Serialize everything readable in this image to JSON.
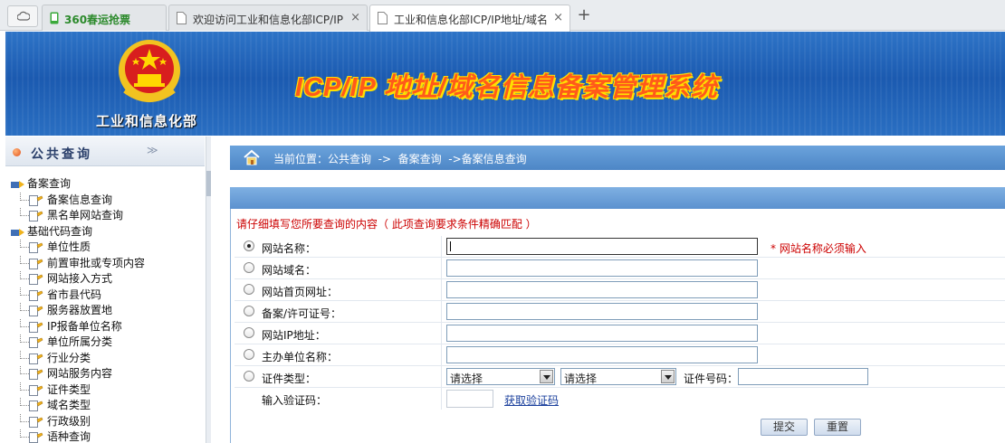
{
  "browser": {
    "tabs": [
      {
        "title": "360春运抢票",
        "active": false
      },
      {
        "title": "欢迎访问工业和信息化部ICP/IP",
        "active": false
      },
      {
        "title": "工业和信息化部ICP/IP地址/域名",
        "active": true
      }
    ],
    "close_glyph": "×",
    "new_tab_glyph": "+"
  },
  "banner": {
    "ministry": "工业和信息化部",
    "title": "ICP/IP 地址/域名信息备案管理系统"
  },
  "sidebar": {
    "title": "公共查询",
    "chevron": "≫",
    "groups": [
      {
        "label": "备案查询",
        "items": [
          "备案信息查询",
          "黑名单网站查询"
        ]
      },
      {
        "label": "基础代码查询",
        "items": [
          "单位性质",
          "前置审批或专项内容",
          "网站接入方式",
          "省市县代码",
          "服务器放置地",
          "IP报备单位名称",
          "单位所属分类",
          "行业分类",
          "网站服务内容",
          "证件类型",
          "域名类型",
          "行政级别",
          "语种查询"
        ]
      }
    ]
  },
  "breadcrumb": {
    "text": "当前位置：公共查询  ->  备案查询  ->备案信息查询"
  },
  "form": {
    "note": "请仔细填写您所要查询的内容（ 此项查询要求条件精确匹配 ）",
    "fields": [
      {
        "label": "网站名称：",
        "value": "",
        "checked": true
      },
      {
        "label": "网站域名：",
        "value": "",
        "checked": false
      },
      {
        "label": "网站首页网址：",
        "value": "",
        "checked": false
      },
      {
        "label": "备案/许可证号：",
        "value": "",
        "checked": false
      },
      {
        "label": "网站IP地址：",
        "value": "",
        "checked": false
      },
      {
        "label": "主办单位名称：",
        "value": "",
        "checked": false
      }
    ],
    "required_hint": "* 网站名称必须输入",
    "cert": {
      "label": "证件类型：",
      "select1": "请选择",
      "select2": "请选择",
      "number_label": "证件号码：",
      "number_value": ""
    },
    "captcha": {
      "label": "输入验证码：",
      "value": "",
      "link": "获取验证码"
    },
    "buttons": {
      "submit": "提交",
      "reset": "重置"
    }
  },
  "colors": {
    "banner_blue": "#1b5ab0",
    "title_orange": "#ff5a1a",
    "title_yellow": "#ffe000",
    "required_red": "#cc0000",
    "link_blue": "#1a3f9c"
  }
}
